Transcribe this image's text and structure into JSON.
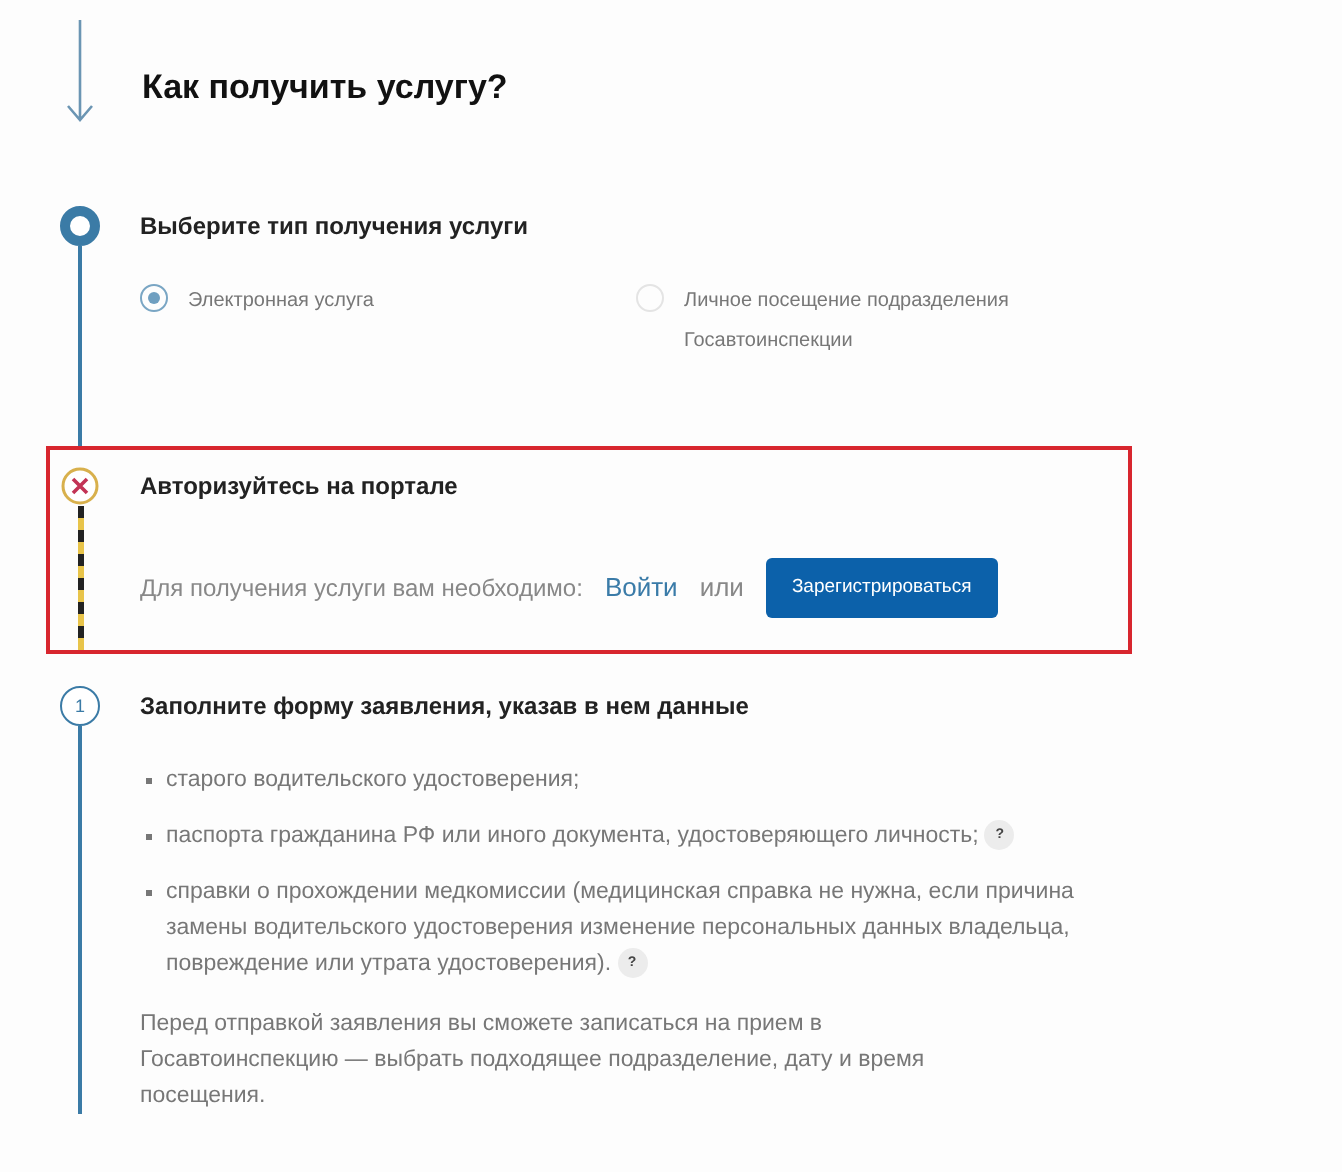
{
  "heading": "Как получить услугу?",
  "steps": [
    {
      "kind": "choice",
      "active": true,
      "error": false,
      "highlighted": false,
      "title": "Выберите тип получения услуги",
      "options": [
        {
          "label": "Электронная услуга",
          "selected": true
        },
        {
          "label": "Личное посещение подразделения Госавтоинспекции",
          "selected": false
        }
      ]
    },
    {
      "kind": "auth",
      "active": false,
      "error": true,
      "highlighted": true,
      "title": "Авторизуйтесь на портале",
      "prompt": "Для получения услуги вам необходимо:",
      "login_link": "Войти",
      "separator": "или",
      "register_button": "Зарегистрироваться"
    },
    {
      "kind": "form",
      "active": false,
      "error": false,
      "highlighted": false,
      "number": "1",
      "title": "Заполните форму заявления, указав в нем данные",
      "items": [
        {
          "text": "старого водительского удостоверения;",
          "help": false
        },
        {
          "text": "паспорта гражданина РФ или иного документа, удостоверяющего личность;",
          "help": "?"
        },
        {
          "text": "справки о прохождении медкомиссии (медицинская справка не нужна, если причина замены водительского удостоверения изменение персональных данных владельца, повреждение или утрата удостоверения).",
          "help": "?"
        }
      ],
      "note": "Перед отправкой заявления вы сможете записаться на прием в Госавтоинспекцию — выбрать подходящее подразделение, дату и время посещения."
    }
  ]
}
